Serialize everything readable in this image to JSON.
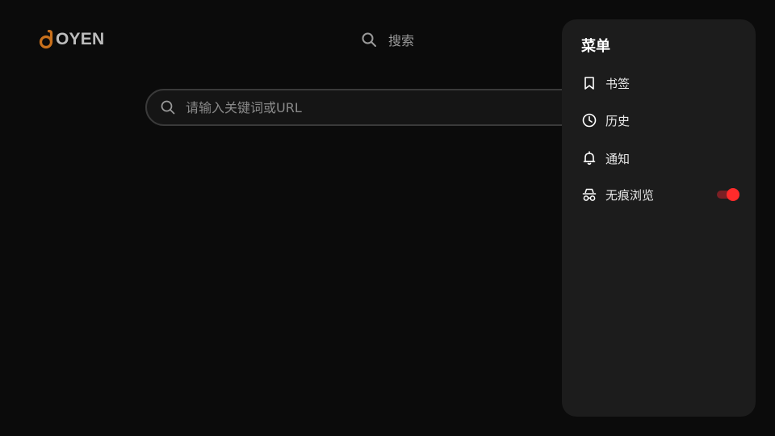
{
  "logo": {
    "text": "OYEN",
    "accent_color": "#c8701c"
  },
  "top_search": {
    "label": "搜索",
    "icon": "search-icon"
  },
  "search_bar": {
    "placeholder": "请输入关键词或URL",
    "value": "",
    "icon": "search-icon"
  },
  "menu": {
    "title": "菜单",
    "items": [
      {
        "label": "书签",
        "icon": "bookmark-icon"
      },
      {
        "label": "历史",
        "icon": "clock-icon"
      },
      {
        "label": "通知",
        "icon": "bell-icon"
      },
      {
        "label": "无痕浏览",
        "icon": "incognito-icon",
        "toggle_on": true,
        "toggle_color": "#ff2b2b"
      }
    ]
  },
  "colors": {
    "background": "#0b0b0b",
    "panel": "#1c1c1c",
    "toggle_active": "#ff2b2b"
  }
}
